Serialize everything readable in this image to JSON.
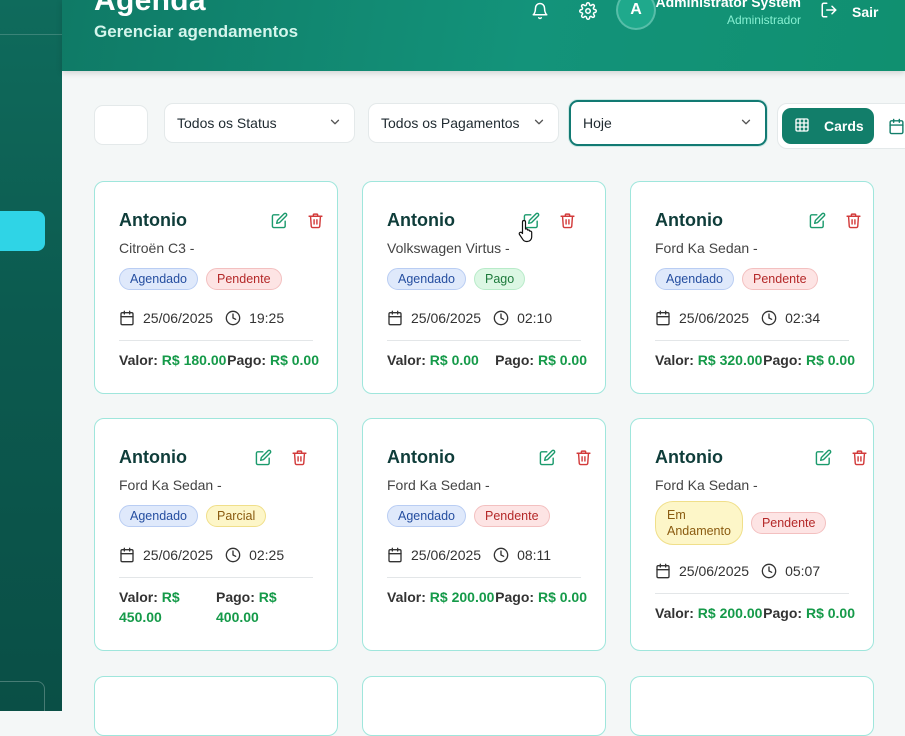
{
  "header": {
    "title": "Agenda",
    "subtitle": "Gerenciar agendamentos",
    "user": {
      "initial": "A",
      "name": "Administrator System",
      "role": "Administrador"
    },
    "logout_label": "Sair",
    "icons": [
      "bell-icon",
      "gear-icon",
      "logout-icon"
    ]
  },
  "filters": {
    "status": "Todos os Status",
    "payments": "Todos os Pagamentos",
    "period": "Hoje"
  },
  "view_toggle": {
    "cards_label": "Cards",
    "active": "cards"
  },
  "colors": {
    "primary": "#127e6a",
    "accent_cyan": "#2fd4e6",
    "money_green": "#159a49",
    "card_border": "#9fe6dc"
  },
  "cards": [
    {
      "name": "Antonio",
      "vehicle": "Citroën C3 -",
      "badges": [
        "Agendado",
        "Pendente"
      ],
      "date": "25/06/2025",
      "time": "19:25",
      "valor_label": "Valor:",
      "valor": "R$ 180.00",
      "pago_label": "Pago:",
      "pago": "R$ 0.00"
    },
    {
      "name": "Antonio",
      "vehicle": "Volkswagen Virtus -",
      "badges": [
        "Agendado",
        "Pago"
      ],
      "date": "25/06/2025",
      "time": "02:10",
      "valor_label": "Valor:",
      "valor": "R$ 0.00",
      "pago_label": "Pago:",
      "pago": "R$ 0.00"
    },
    {
      "name": "Antonio",
      "vehicle": "Ford Ka Sedan -",
      "badges": [
        "Agendado",
        "Pendente"
      ],
      "date": "25/06/2025",
      "time": "02:34",
      "valor_label": "Valor:",
      "valor": "R$ 320.00",
      "pago_label": "Pago:",
      "pago": "R$ 0.00"
    },
    {
      "name": "Antonio",
      "vehicle": "Ford Ka Sedan -",
      "badges": [
        "Agendado",
        "Parcial"
      ],
      "date": "25/06/2025",
      "time": "02:25",
      "valor_label": "Valor:",
      "valor": "R$ 450.00",
      "pago_label": "Pago:",
      "pago": "R$ 400.00"
    },
    {
      "name": "Antonio",
      "vehicle": "Ford Ka Sedan -",
      "badges": [
        "Agendado",
        "Pendente"
      ],
      "date": "25/06/2025",
      "time": "08:11",
      "valor_label": "Valor:",
      "valor": "R$ 200.00",
      "pago_label": "Pago:",
      "pago": "R$ 0.00"
    },
    {
      "name": "Antonio",
      "vehicle": "Ford Ka Sedan -",
      "badges": [
        "Em Andamento",
        "Pendente"
      ],
      "date": "25/06/2025",
      "time": "05:07",
      "valor_label": "Valor:",
      "valor": "R$ 200.00",
      "pago_label": "Pago:",
      "pago": "R$ 0.00"
    }
  ]
}
